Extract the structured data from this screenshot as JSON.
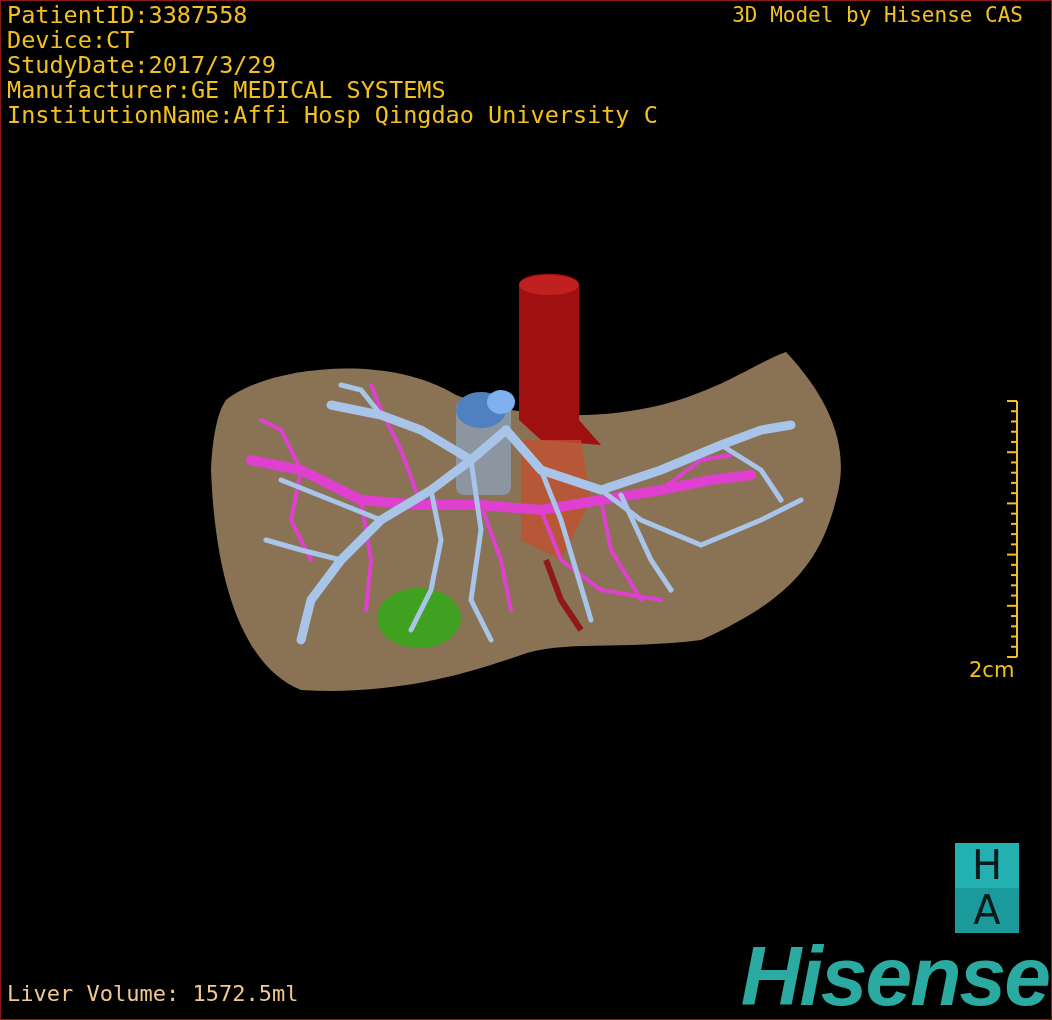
{
  "info_lines": [
    "PatientID:3387558",
    "Device:CT",
    "StudyDate:2017/3/29",
    "Manufacturer:GE MEDICAL SYSTEMS",
    "InstitutionName:Affi Hosp Qingdao University C"
  ],
  "title": "3D Model by Hisense CAS",
  "scale": {
    "label": "2cm"
  },
  "volume": "Liver Volume: 1572.5ml",
  "logo": {
    "badge_top": "H",
    "badge_bottom": "A",
    "wordmark": "Hisense"
  }
}
